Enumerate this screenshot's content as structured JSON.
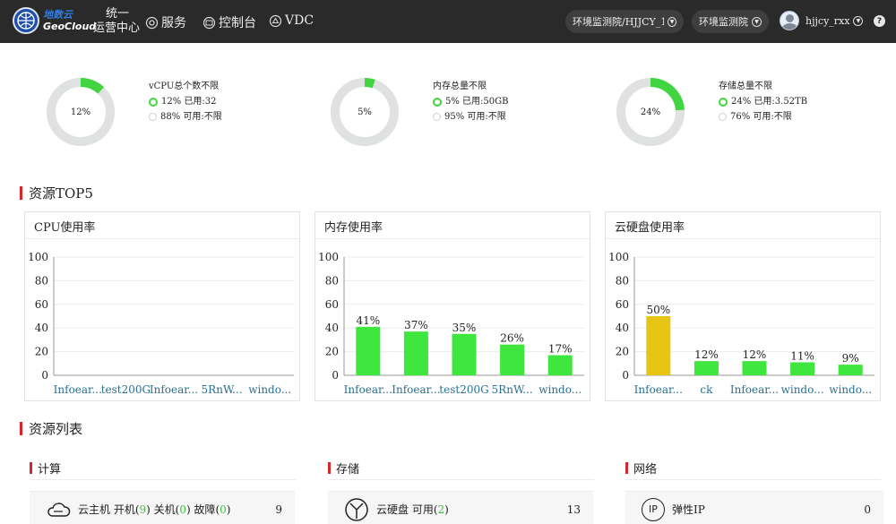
{
  "header": {
    "logo_cn": "地数云",
    "logo_en": "GeoCloud",
    "sys_title_line1": "统一",
    "sys_title_line2": "运营中心",
    "nav": [
      {
        "label": "服务",
        "icon": "service-icon"
      },
      {
        "label": "控制台",
        "icon": "console-icon"
      },
      {
        "label": "VDC",
        "icon": "vdc-icon"
      }
    ],
    "project_select": "环境监测院/HJJCY_1...",
    "org_select": "环境监测院",
    "username": "hjjcy_rxx",
    "help_label": "?"
  },
  "summary": [
    {
      "title": "vCPU总个数不限",
      "percent_label": "12%",
      "percent": 12,
      "used": "12% 已用:32",
      "free": "88% 可用:不限"
    },
    {
      "title": "内存总量不限",
      "percent_label": "5%",
      "percent": 5,
      "used": "5% 已用:50GB",
      "free": "95% 可用:不限"
    },
    {
      "title": "存储总量不限",
      "percent_label": "24%",
      "percent": 24,
      "used": "24% 已用:3.52TB",
      "free": "76% 可用:不限"
    }
  ],
  "top5_title": "资源TOP5",
  "panels": [
    {
      "title": "CPU使用率"
    },
    {
      "title": "内存使用率"
    },
    {
      "title": "云硬盘使用率"
    }
  ],
  "chart_data": [
    {
      "type": "bar",
      "title": "CPU使用率",
      "categories": [
        "Infoear...",
        "test200G",
        "Infoear...",
        "5RnW...",
        "windo..."
      ],
      "values": [
        0,
        0,
        0,
        0,
        0
      ],
      "value_labels": [
        "",
        "",
        "",
        "",
        ""
      ],
      "ylim": [
        0,
        100
      ],
      "yticks": [
        "0",
        "20",
        "40",
        "60",
        "80",
        "100"
      ],
      "colors": [
        "#3ee63e",
        "#3ee63e",
        "#3ee63e",
        "#3ee63e",
        "#3ee63e"
      ]
    },
    {
      "type": "bar",
      "title": "内存使用率",
      "categories": [
        "Infoear...",
        "Infoear...",
        "test200G",
        "5RnW...",
        "windo..."
      ],
      "values": [
        41,
        37,
        35,
        26,
        17
      ],
      "value_labels": [
        "41%",
        "37%",
        "35%",
        "26%",
        "17%"
      ],
      "ylim": [
        0,
        100
      ],
      "yticks": [
        "0",
        "20",
        "40",
        "60",
        "80",
        "100"
      ],
      "colors": [
        "#3ee63e",
        "#3ee63e",
        "#3ee63e",
        "#3ee63e",
        "#3ee63e"
      ]
    },
    {
      "type": "bar",
      "title": "云硬盘使用率",
      "categories": [
        "Infoear...",
        "ck",
        "Infoear...",
        "windo...",
        "windo..."
      ],
      "values": [
        50,
        12,
        12,
        11,
        9
      ],
      "value_labels": [
        "50%",
        "12%",
        "12%",
        "11%",
        "9%"
      ],
      "ylim": [
        0,
        100
      ],
      "yticks": [
        "0",
        "20",
        "40",
        "60",
        "80",
        "100"
      ],
      "colors": [
        "#e6c613",
        "#3ee63e",
        "#3ee63e",
        "#3ee63e",
        "#3ee63e"
      ]
    }
  ],
  "list_title": "资源列表",
  "list_sections": {
    "compute": {
      "title": "计算",
      "label": "云主机 开机(",
      "on": "9",
      "mid1": ") 关机(",
      "off": "0",
      "mid2": ") 故障(",
      "fault": "0",
      "end": ")",
      "count": "9"
    },
    "storage": {
      "title": "存储",
      "label": "云硬盘 可用(",
      "avail": "2",
      "end": ")",
      "count": "13"
    },
    "network": {
      "title": "网络",
      "icon_text": "IP",
      "label": "弹性IP",
      "count": "0"
    }
  },
  "colors": {
    "accent_red": "#d9262e",
    "used_green": "#41d641",
    "bar_green": "#3ee63e",
    "bar_yellow": "#e6c613",
    "ring_gray": "#dfe2e0",
    "topbar": "#2a2a2a"
  }
}
